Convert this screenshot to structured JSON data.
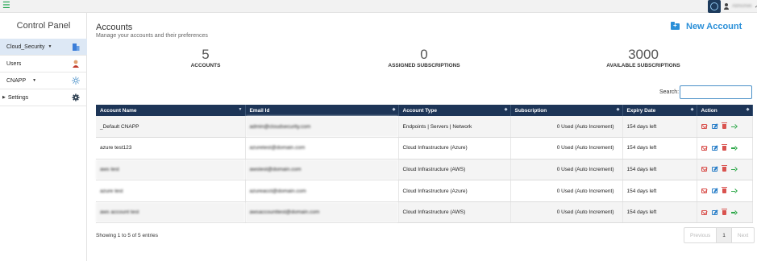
{
  "topbar": {
    "user_name": "Abhishek"
  },
  "sidebar": {
    "title": "Control Panel",
    "items": [
      {
        "label": "Cloud_Security",
        "icon": "building-icon",
        "active": true,
        "dropdown": true
      },
      {
        "label": "Users",
        "icon": "user-icon"
      },
      {
        "label": "CNAPP",
        "icon": "sun-icon",
        "dropdown": true
      },
      {
        "label": "Settings",
        "icon": "gear-icon",
        "expandable": true
      }
    ]
  },
  "main": {
    "title": "Accounts",
    "subtitle": "Manage your accounts and their preferences",
    "new_button": "New Account",
    "stats": [
      {
        "value": "5",
        "label": "ACCOUNTS"
      },
      {
        "value": "0",
        "label": "ASSIGNED SUBSCRIPTIONS"
      },
      {
        "value": "3000",
        "label": "AVAILABLE SUBSCRIPTIONS"
      }
    ],
    "search_label": "Search:",
    "search_value": "",
    "columns": [
      "Account Name",
      "Email Id",
      "Account Type",
      "Subscription",
      "Expiry Date",
      "Action"
    ],
    "rows": [
      {
        "name": "_Default CNAPP",
        "email": "admin@cloudsecurity.com",
        "type": "Endpoints | Servers | Network",
        "sub": "0 Used (Auto Increment)",
        "expiry": "154 days left"
      },
      {
        "name": "azure test123",
        "email": "azuretest@domain.com",
        "type": "Cloud Infrastructure (Azure)",
        "sub": "0 Used (Auto Increment)",
        "expiry": "154 days left"
      },
      {
        "name": "aws test",
        "email": "awstest@domain.com",
        "type": "Cloud Infrastructure (AWS)",
        "sub": "0 Used (Auto Increment)",
        "expiry": "154 days left"
      },
      {
        "name": "azure test",
        "email": "azureacct@domain.com",
        "type": "Cloud Infrastructure (Azure)",
        "sub": "0 Used (Auto Increment)",
        "expiry": "154 days left"
      },
      {
        "name": "aws account test",
        "email": "awsaccounttest@domain.com",
        "type": "Cloud Infrastructure (AWS)",
        "sub": "0 Used (Auto Increment)",
        "expiry": "154 days left"
      }
    ],
    "showing": "Showing 1 to 5 of 5 entries",
    "pager": {
      "prev": "Previous",
      "page": "1",
      "next": "Next"
    }
  }
}
